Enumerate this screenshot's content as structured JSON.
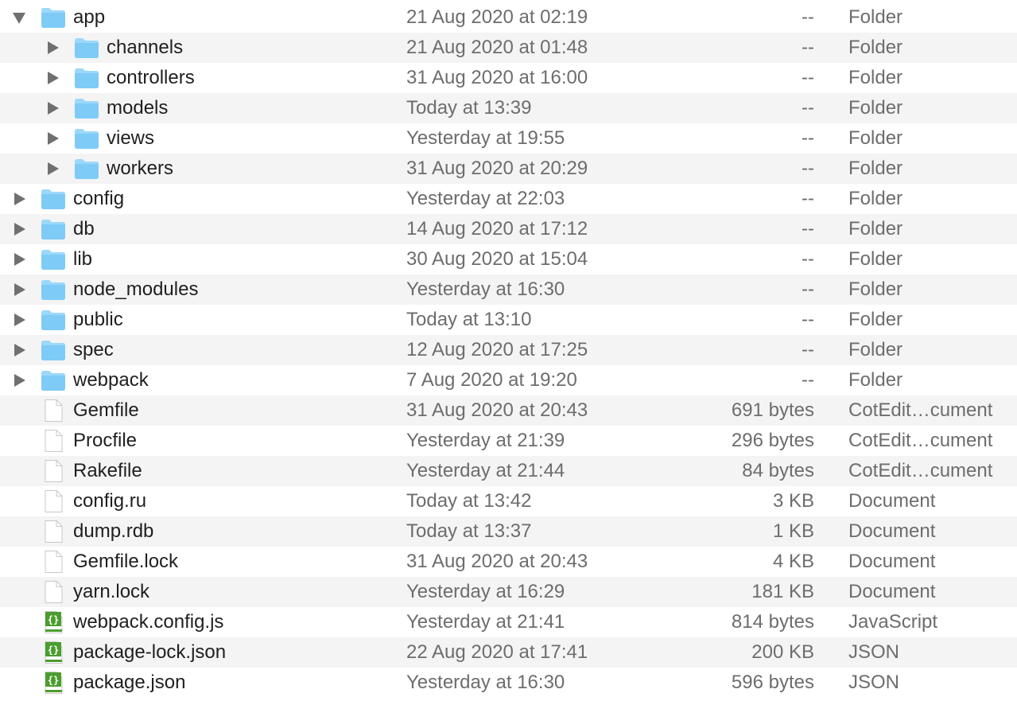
{
  "colors": {
    "folder_fill": "#7ecbf7",
    "folder_tab": "#9bd8fa",
    "doc_fill": "#ffffff",
    "doc_stroke": "#c8c8c8",
    "js_green": "#4a9d2e",
    "row_stripe": "#f4f4f5"
  },
  "rows": [
    {
      "name": "app",
      "date": "21 Aug 2020 at 02:19",
      "size": "--",
      "kind": "Folder",
      "icon": "folder-icon",
      "depth": 0,
      "disclosure": "expanded"
    },
    {
      "name": "channels",
      "date": "21 Aug 2020 at 01:48",
      "size": "--",
      "kind": "Folder",
      "icon": "folder-icon",
      "depth": 1,
      "disclosure": "collapsed"
    },
    {
      "name": "controllers",
      "date": "31 Aug 2020 at 16:00",
      "size": "--",
      "kind": "Folder",
      "icon": "folder-icon",
      "depth": 1,
      "disclosure": "collapsed"
    },
    {
      "name": "models",
      "date": "Today at 13:39",
      "size": "--",
      "kind": "Folder",
      "icon": "folder-icon",
      "depth": 1,
      "disclosure": "collapsed"
    },
    {
      "name": "views",
      "date": "Yesterday at 19:55",
      "size": "--",
      "kind": "Folder",
      "icon": "folder-icon",
      "depth": 1,
      "disclosure": "collapsed"
    },
    {
      "name": "workers",
      "date": "31 Aug 2020 at 20:29",
      "size": "--",
      "kind": "Folder",
      "icon": "folder-icon",
      "depth": 1,
      "disclosure": "collapsed"
    },
    {
      "name": "config",
      "date": "Yesterday at 22:03",
      "size": "--",
      "kind": "Folder",
      "icon": "folder-icon",
      "depth": 0,
      "disclosure": "collapsed"
    },
    {
      "name": "db",
      "date": "14 Aug 2020 at 17:12",
      "size": "--",
      "kind": "Folder",
      "icon": "folder-icon",
      "depth": 0,
      "disclosure": "collapsed"
    },
    {
      "name": "lib",
      "date": "30 Aug 2020 at 15:04",
      "size": "--",
      "kind": "Folder",
      "icon": "folder-icon",
      "depth": 0,
      "disclosure": "collapsed"
    },
    {
      "name": "node_modules",
      "date": "Yesterday at 16:30",
      "size": "--",
      "kind": "Folder",
      "icon": "folder-icon",
      "depth": 0,
      "disclosure": "collapsed"
    },
    {
      "name": "public",
      "date": "Today at 13:10",
      "size": "--",
      "kind": "Folder",
      "icon": "folder-icon",
      "depth": 0,
      "disclosure": "collapsed"
    },
    {
      "name": "spec",
      "date": "12 Aug 2020 at 17:25",
      "size": "--",
      "kind": "Folder",
      "icon": "folder-icon",
      "depth": 0,
      "disclosure": "collapsed"
    },
    {
      "name": "webpack",
      "date": "7 Aug 2020 at 19:20",
      "size": "--",
      "kind": "Folder",
      "icon": "folder-icon",
      "depth": 0,
      "disclosure": "collapsed"
    },
    {
      "name": "Gemfile",
      "date": "31 Aug 2020 at 20:43",
      "size": "691 bytes",
      "kind": "CotEdit…cument",
      "icon": "document-icon",
      "depth": 0,
      "disclosure": "none"
    },
    {
      "name": "Procfile",
      "date": "Yesterday at 21:39",
      "size": "296 bytes",
      "kind": "CotEdit…cument",
      "icon": "document-icon",
      "depth": 0,
      "disclosure": "none"
    },
    {
      "name": "Rakefile",
      "date": "Yesterday at 21:44",
      "size": "84 bytes",
      "kind": "CotEdit…cument",
      "icon": "document-icon",
      "depth": 0,
      "disclosure": "none"
    },
    {
      "name": "config.ru",
      "date": "Today at 13:42",
      "size": "3 KB",
      "kind": "Document",
      "icon": "document-icon",
      "depth": 0,
      "disclosure": "none"
    },
    {
      "name": "dump.rdb",
      "date": "Today at 13:37",
      "size": "1 KB",
      "kind": "Document",
      "icon": "document-icon",
      "depth": 0,
      "disclosure": "none"
    },
    {
      "name": "Gemfile.lock",
      "date": "31 Aug 2020 at 20:43",
      "size": "4 KB",
      "kind": "Document",
      "icon": "document-icon",
      "depth": 0,
      "disclosure": "none"
    },
    {
      "name": "yarn.lock",
      "date": "Yesterday at 16:29",
      "size": "181 KB",
      "kind": "Document",
      "icon": "document-icon",
      "depth": 0,
      "disclosure": "none"
    },
    {
      "name": "webpack.config.js",
      "date": "Yesterday at 21:41",
      "size": "814 bytes",
      "kind": "JavaScript",
      "icon": "code-file-icon",
      "depth": 0,
      "disclosure": "none"
    },
    {
      "name": "package-lock.json",
      "date": "22 Aug 2020 at 17:41",
      "size": "200 KB",
      "kind": "JSON",
      "icon": "code-file-icon",
      "depth": 0,
      "disclosure": "none"
    },
    {
      "name": "package.json",
      "date": "Yesterday at 16:30",
      "size": "596 bytes",
      "kind": "JSON",
      "icon": "code-file-icon",
      "depth": 0,
      "disclosure": "none"
    }
  ]
}
